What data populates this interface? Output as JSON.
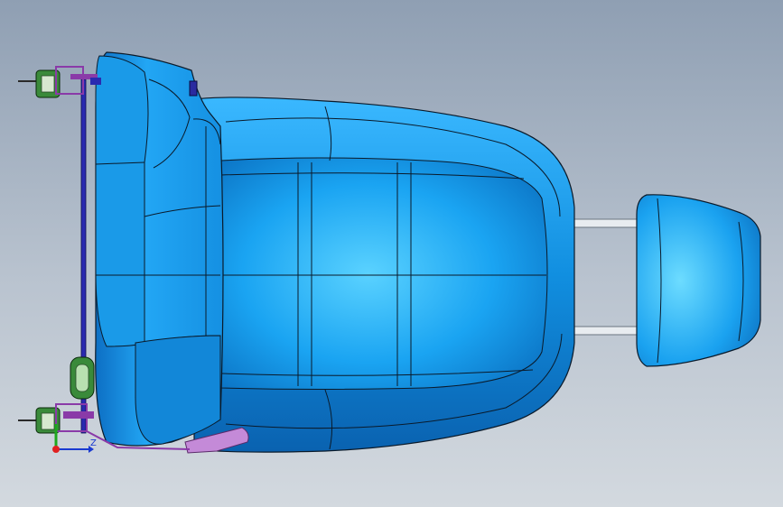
{
  "viewport": {
    "background_top": "#8f9fb3",
    "background_bottom": "#d3d9df"
  },
  "model": {
    "surface_color": "#1a9ef0",
    "edge_color": "#0a1a2a",
    "bracket_colors": [
      "#2e8b2e",
      "#8b3aa8",
      "#2a2aa0",
      "#ffffff"
    ]
  },
  "triad": {
    "z_label": "Z",
    "x_color": "#1a3ad0",
    "y_color": "#1ea81e",
    "origin_color": "#e02020"
  }
}
